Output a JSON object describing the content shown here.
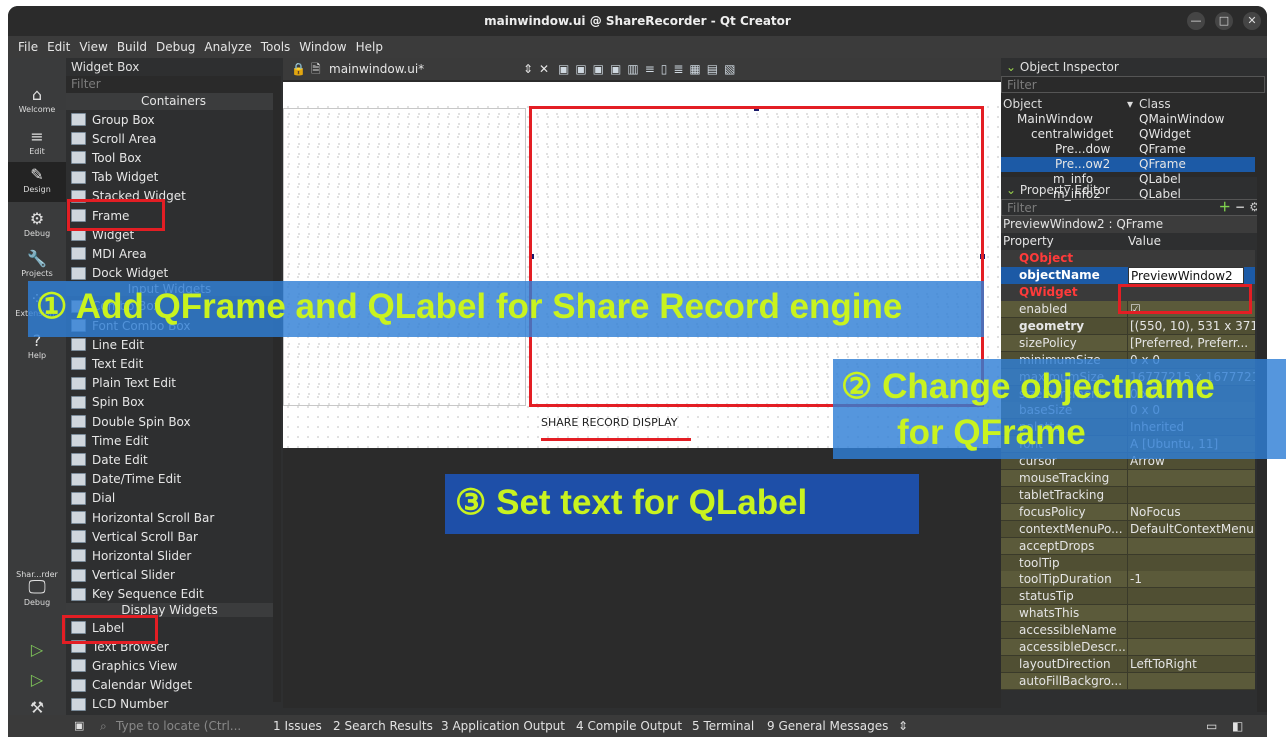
{
  "window": {
    "title": "mainwindow.ui @ ShareRecorder - Qt Creator"
  },
  "menu": [
    "File",
    "Edit",
    "View",
    "Build",
    "Debug",
    "Analyze",
    "Tools",
    "Window",
    "Help"
  ],
  "modes": [
    {
      "label": "Welcome",
      "icon": "home-icon"
    },
    {
      "label": "Edit",
      "icon": "edit-icon"
    },
    {
      "label": "Design",
      "icon": "design-icon"
    },
    {
      "label": "Debug",
      "icon": "debug-icon"
    },
    {
      "label": "Projects",
      "icon": "projects-icon"
    },
    {
      "label": "Extensions",
      "icon": "extensions-icon"
    },
    {
      "label": "Help",
      "icon": "help-icon"
    }
  ],
  "kit": {
    "project": "Shar...rder",
    "build": "Debug"
  },
  "widget_box": {
    "title": "Widget Box",
    "filter_placeholder": "Filter",
    "categories": {
      "containers": "Containers",
      "input": "Input Widgets",
      "display": "Display Widgets"
    },
    "containers": [
      "Group Box",
      "Scroll Area",
      "Tool Box",
      "Tab Widget",
      "Stacked Widget",
      "Frame",
      "Widget",
      "MDI Area",
      "Dock Widget"
    ],
    "inputs": [
      "Combo Box",
      "Font Combo Box",
      "Line Edit",
      "Text Edit",
      "Plain Text Edit",
      "Spin Box",
      "Double Spin Box",
      "Time Edit",
      "Date Edit",
      "Date/Time Edit",
      "Dial",
      "Horizontal Scroll Bar",
      "Vertical Scroll Bar",
      "Horizontal Slider",
      "Vertical Slider",
      "Key Sequence Edit"
    ],
    "display": [
      "Label",
      "Text Browser",
      "Graphics View",
      "Calendar Widget",
      "LCD Number"
    ]
  },
  "editor": {
    "file_tab": "mainwindow.ui*"
  },
  "form": {
    "label_text": "SHARE RECORD DISPLAY"
  },
  "object_inspector": {
    "title": "Object Inspector",
    "filter_placeholder": "Filter",
    "col_object": "Object",
    "col_class": "Class",
    "rows": [
      {
        "object": "MainWindow",
        "class": "QMainWindow"
      },
      {
        "object": "centralwidget",
        "class": "QWidget"
      },
      {
        "object": "Pre...dow",
        "class": "QFrame"
      },
      {
        "object": "Pre...ow2",
        "class": "QFrame"
      },
      {
        "object": "m_info",
        "class": "QLabel"
      },
      {
        "object": "m_info2",
        "class": "QLabel"
      }
    ]
  },
  "property_editor": {
    "title": "Property Editor",
    "filter_placeholder": "Filter",
    "context": "PreviewWindow2 : QFrame",
    "col_property": "Property",
    "col_value": "Value",
    "section_qobject": "QObject",
    "section_qwidget": "QWidget",
    "objectName": {
      "name": "objectName",
      "value": "PreviewWindow2"
    },
    "rows": [
      {
        "name": "enabled",
        "value": "☑"
      },
      {
        "name": "geometry",
        "value": "[(550, 10), 531 x 371]"
      },
      {
        "name": "sizePolicy",
        "value": "[Preferred, Preferr..."
      },
      {
        "name": "minimumSize",
        "value": "0 x 0"
      },
      {
        "name": "maximumSize",
        "value": "16777215 x 16777215"
      },
      {
        "name": "sizeIncrement",
        "value": "0 x 0"
      },
      {
        "name": "baseSize",
        "value": "0 x 0"
      },
      {
        "name": "palette",
        "value": "Inherited"
      },
      {
        "name": "font",
        "value": "A  [Ubuntu, 11]"
      },
      {
        "name": "cursor",
        "value": "Arrow"
      },
      {
        "name": "mouseTracking",
        "value": ""
      },
      {
        "name": "tabletTracking",
        "value": ""
      },
      {
        "name": "focusPolicy",
        "value": "NoFocus"
      },
      {
        "name": "contextMenuPo...",
        "value": "DefaultContextMenu"
      },
      {
        "name": "acceptDrops",
        "value": ""
      },
      {
        "name": "toolTip",
        "value": ""
      },
      {
        "name": "toolTipDuration",
        "value": "-1"
      },
      {
        "name": "statusTip",
        "value": ""
      },
      {
        "name": "whatsThis",
        "value": ""
      },
      {
        "name": "accessibleName",
        "value": ""
      },
      {
        "name": "accessibleDescr...",
        "value": ""
      },
      {
        "name": "layoutDirection",
        "value": "LeftToRight"
      },
      {
        "name": "autoFillBackgro...",
        "value": ""
      }
    ]
  },
  "statusbar": {
    "locator_placeholder": "Type to locate (Ctrl...",
    "panes": [
      "1  Issues",
      "2  Search Results",
      "3  Application Output",
      "4  Compile Output",
      "5  Terminal",
      "9  General Messages"
    ]
  },
  "annotations": {
    "a1": "①  Add QFrame and QLabel for Share Record engine",
    "a2_line1": "②  Change objectname",
    "a2_line2": "for QFrame",
    "a3": "③  Set text for QLabel"
  },
  "colors": {
    "highlight": "#e31e24",
    "annotation_text": "#c9f31f",
    "annotation_bg": "#2f7fd6",
    "property_yellow": "#5b5a3a",
    "selection": "#1c5aa6"
  }
}
